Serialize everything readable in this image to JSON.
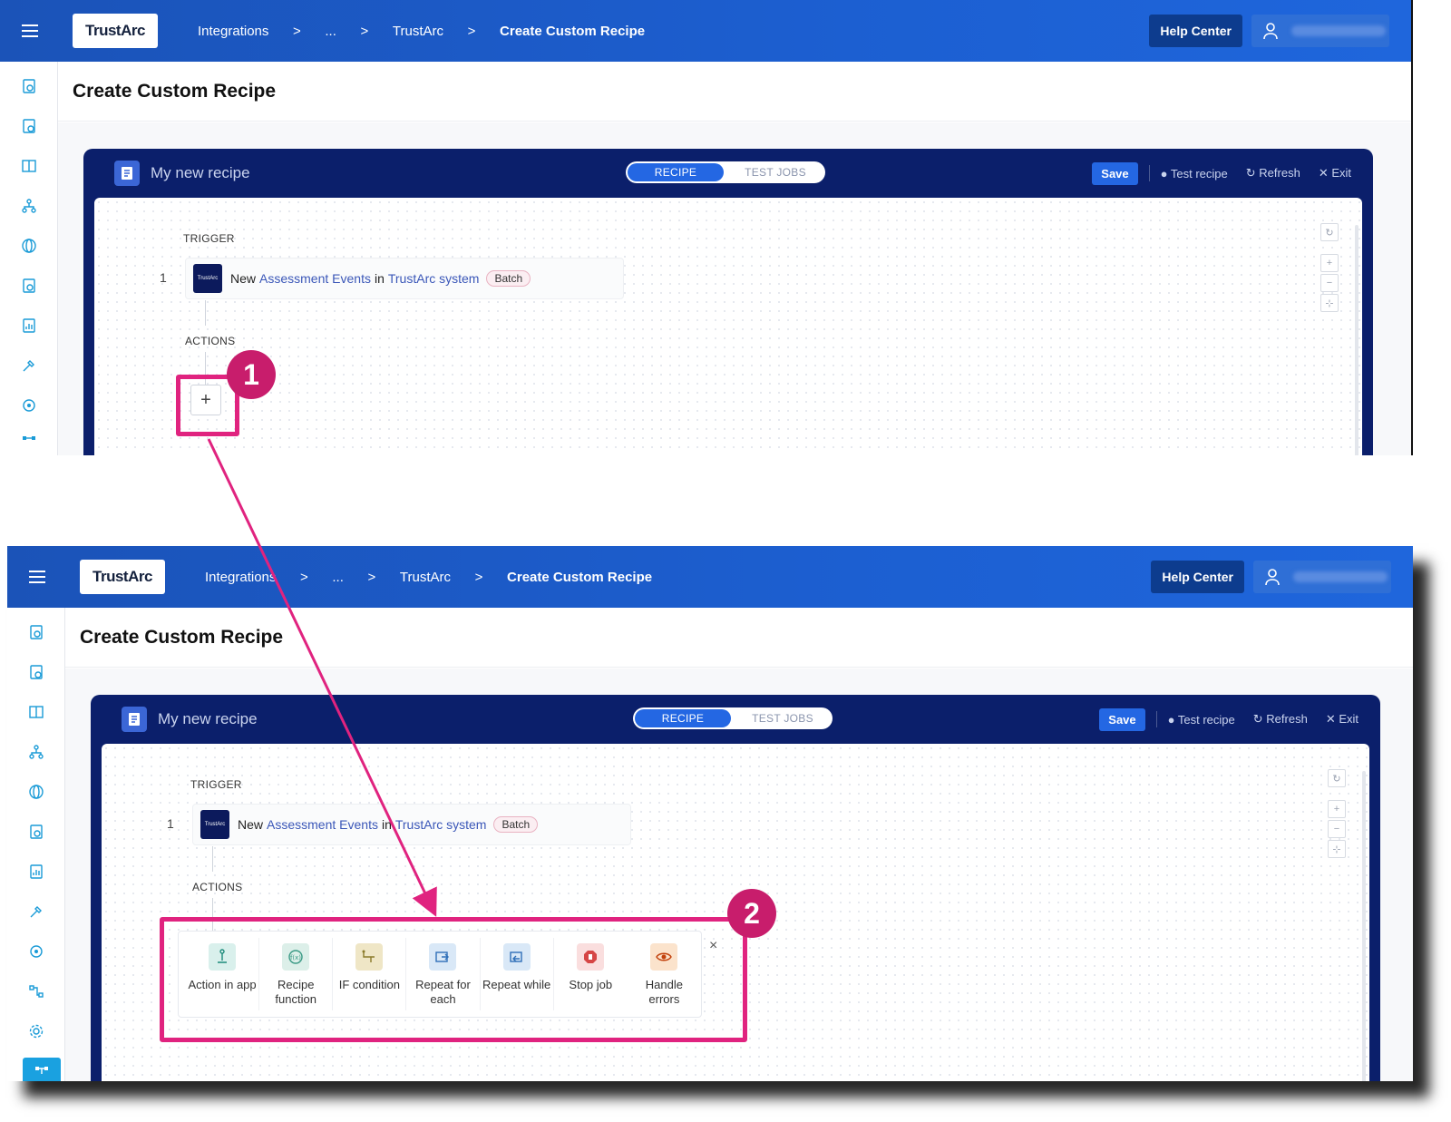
{
  "header": {
    "logo_text": "TrustArc",
    "breadcrumbs": [
      "Integrations",
      "...",
      "TrustArc",
      "Create Custom Recipe"
    ],
    "separator": ">",
    "help_center": "Help Center"
  },
  "page": {
    "title": "Create Custom Recipe"
  },
  "recipe": {
    "name": "My new recipe",
    "tabs": [
      "RECIPE",
      "TEST JOBS"
    ],
    "active_tab": "RECIPE",
    "save": "Save",
    "test_recipe": "Test recipe",
    "refresh": "Refresh",
    "exit": "Exit"
  },
  "canvas": {
    "trigger_label": "TRIGGER",
    "actions_label": "ACTIONS",
    "step_number": "1",
    "app_logo_text": "TrustArc",
    "trigger_parts": {
      "new": "New",
      "object": "Assessment Events",
      "in": "in",
      "app": "TrustArc system"
    },
    "batch_badge": "Batch",
    "add_step": "+"
  },
  "palette": {
    "items": [
      {
        "label": "Action in app",
        "icon": "action-in-app-icon",
        "color": "#d9f0ec"
      },
      {
        "label": "Recipe function",
        "icon": "recipe-function-icon",
        "color": "#dcefe9"
      },
      {
        "label": "IF condition",
        "icon": "if-condition-icon",
        "color": "#efe6c6"
      },
      {
        "label": "Repeat for each",
        "icon": "repeat-for-each-icon",
        "color": "#d9e8f7"
      },
      {
        "label": "Repeat while",
        "icon": "repeat-while-icon",
        "color": "#d9e8f7"
      },
      {
        "label": "Stop job",
        "icon": "stop-job-icon",
        "color": "#fadede"
      },
      {
        "label": "Handle errors",
        "icon": "handle-errors-icon",
        "color": "#fbe3cc"
      }
    ],
    "close": "×"
  },
  "callouts": [
    "1",
    "2"
  ],
  "colors": {
    "header_blue": "#1c5fd1",
    "recipe_navy": "#0b1f6b",
    "accent_blue": "#2467e3",
    "callout_magenta": "#e0237f"
  }
}
